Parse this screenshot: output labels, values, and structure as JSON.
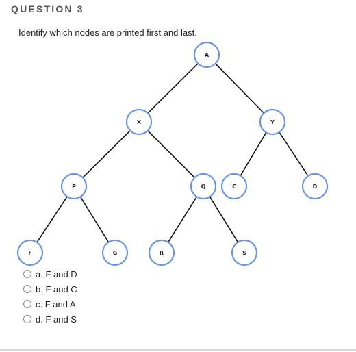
{
  "question": {
    "title": "QUESTION 3",
    "prompt": "Identify which nodes are printed first and last."
  },
  "tree": {
    "node_color": "#6b96de",
    "nodes": [
      {
        "id": "A",
        "label": "A"
      },
      {
        "id": "X",
        "label": "X"
      },
      {
        "id": "Y",
        "label": "Y"
      },
      {
        "id": "P",
        "label": "P"
      },
      {
        "id": "Q",
        "label": "Q"
      },
      {
        "id": "C",
        "label": "C"
      },
      {
        "id": "D",
        "label": "D"
      },
      {
        "id": "F",
        "label": "F"
      },
      {
        "id": "G",
        "label": "G"
      },
      {
        "id": "R",
        "label": "R"
      },
      {
        "id": "S",
        "label": "S"
      }
    ],
    "edges": [
      [
        "A",
        "X"
      ],
      [
        "A",
        "Y"
      ],
      [
        "X",
        "P"
      ],
      [
        "X",
        "Q"
      ],
      [
        "Y",
        "C"
      ],
      [
        "Y",
        "D"
      ],
      [
        "P",
        "F"
      ],
      [
        "P",
        "G"
      ],
      [
        "Q",
        "R"
      ],
      [
        "Q",
        "S"
      ]
    ]
  },
  "options": [
    {
      "label": "a. F and D",
      "selected": false
    },
    {
      "label": "b. F and C",
      "selected": false
    },
    {
      "label": "c. F and A",
      "selected": false
    },
    {
      "label": "d. F and S",
      "selected": false
    }
  ]
}
